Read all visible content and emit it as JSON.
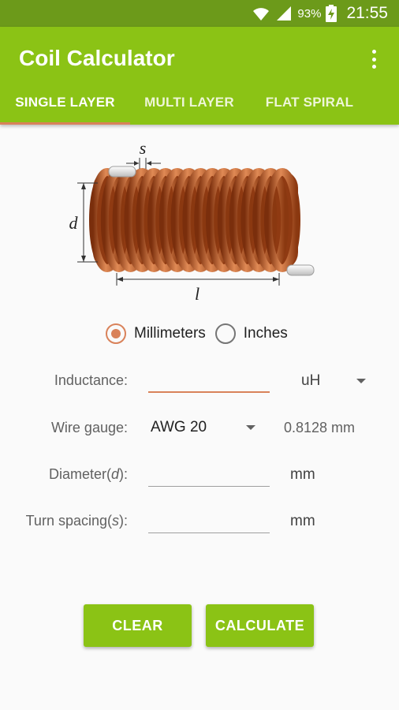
{
  "status_bar": {
    "battery_pct": "93%",
    "time": "21:55"
  },
  "app": {
    "title": "Coil Calculator"
  },
  "tabs": [
    {
      "label": "SINGLE LAYER",
      "active": true
    },
    {
      "label": "MULTI LAYER",
      "active": false
    },
    {
      "label": "FLAT SPIRAL",
      "active": false
    }
  ],
  "figure": {
    "label_s": "s",
    "label_d": "d",
    "label_l": "l"
  },
  "units_choice": {
    "options": [
      "Millimeters",
      "Inches"
    ],
    "selected": "Millimeters"
  },
  "form": {
    "inductance": {
      "label": "Inductance:",
      "value": "",
      "unit": "uH"
    },
    "wire_gauge": {
      "label": "Wire gauge:",
      "value": "AWG 20",
      "diameter": "0.8128 mm"
    },
    "diameter": {
      "label_prefix": "Diameter(",
      "label_var": "d",
      "label_suffix": "):",
      "value": "",
      "unit": "mm"
    },
    "turn_spacing": {
      "label_prefix": "Turn spacing(",
      "label_var": "s",
      "label_suffix": "):",
      "value": "",
      "unit": "mm"
    }
  },
  "buttons": {
    "clear": "CLEAR",
    "calculate": "CALCULATE"
  },
  "colors": {
    "app_bar": "#8bc315",
    "status_bar": "#6c9a1a",
    "accent": "#d9825a",
    "copper": "#b8521f"
  }
}
